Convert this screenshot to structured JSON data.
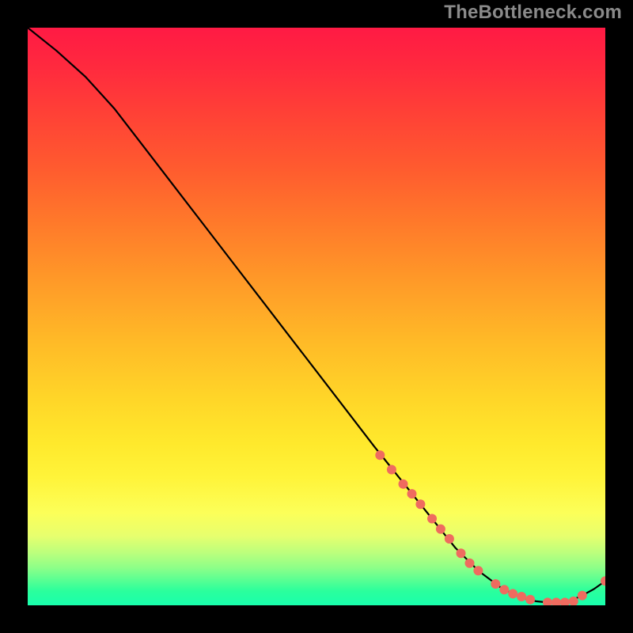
{
  "watermark": "TheBottleneck.com",
  "colors": {
    "frame": "#000000",
    "line": "#000000",
    "marker": "#ef6b5f",
    "gradient_top": "#ff1a44",
    "gradient_bottom": "#19ffad"
  },
  "chart_data": {
    "type": "line",
    "title": "",
    "xlabel": "",
    "ylabel": "",
    "xlim": [
      0,
      100
    ],
    "ylim": [
      0,
      100
    ],
    "grid": false,
    "x": [
      0,
      5,
      10,
      15,
      20,
      25,
      30,
      35,
      40,
      45,
      50,
      55,
      60,
      62,
      64,
      66,
      68,
      70,
      72,
      74,
      76,
      78,
      80,
      82,
      84,
      86,
      88,
      90,
      92,
      94,
      96,
      98,
      100
    ],
    "y": [
      100,
      96,
      91.5,
      86,
      79.5,
      73,
      66.5,
      60,
      53.5,
      47,
      40.5,
      34,
      27.5,
      25,
      22.5,
      20,
      17.5,
      15,
      12.5,
      10,
      8,
      6,
      4.5,
      3,
      2,
      1.2,
      0.7,
      0.5,
      0.5,
      0.8,
      1.7,
      2.8,
      4.2
    ],
    "markers_x": [
      61,
      63,
      65,
      66.5,
      68,
      70,
      71.5,
      73,
      75,
      76.5,
      78,
      81,
      82.5,
      84,
      85.5,
      87,
      90,
      91.5,
      93,
      94.5,
      96,
      100
    ],
    "markers_y": [
      26,
      23.5,
      21,
      19.3,
      17.5,
      15,
      13.2,
      11.5,
      9,
      7.3,
      6,
      3.7,
      2.7,
      2,
      1.5,
      1,
      0.5,
      0.5,
      0.5,
      0.7,
      1.7,
      4.2
    ],
    "annotations": []
  }
}
